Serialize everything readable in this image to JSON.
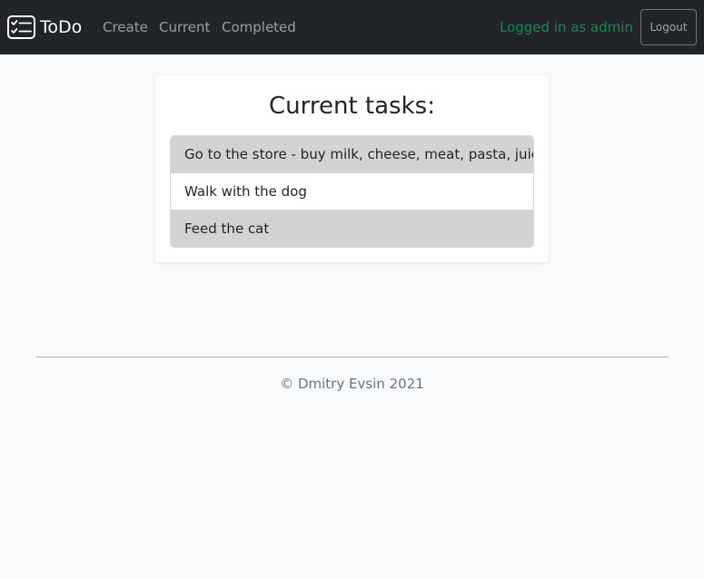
{
  "navbar": {
    "brand": {
      "icon": "checklist-icon",
      "label": "ToDo"
    },
    "links": {
      "create": "Create",
      "current": "Current",
      "completed": "Completed"
    },
    "logged_in_text": "Logged in as admin",
    "logout_label": "Logout"
  },
  "main": {
    "title": "Current tasks:",
    "tasks": [
      "Go to the store - buy milk, cheese, meat, pasta, juice",
      "Walk with the dog",
      "Feed the cat"
    ]
  },
  "footer": {
    "text": "© Dmitry Evsin 2021"
  },
  "colors": {
    "navbar_bg": "#212529",
    "logged_in": "#198754",
    "task_shaded": "#d3d3d3",
    "page_bg": "#f8f9fa"
  }
}
